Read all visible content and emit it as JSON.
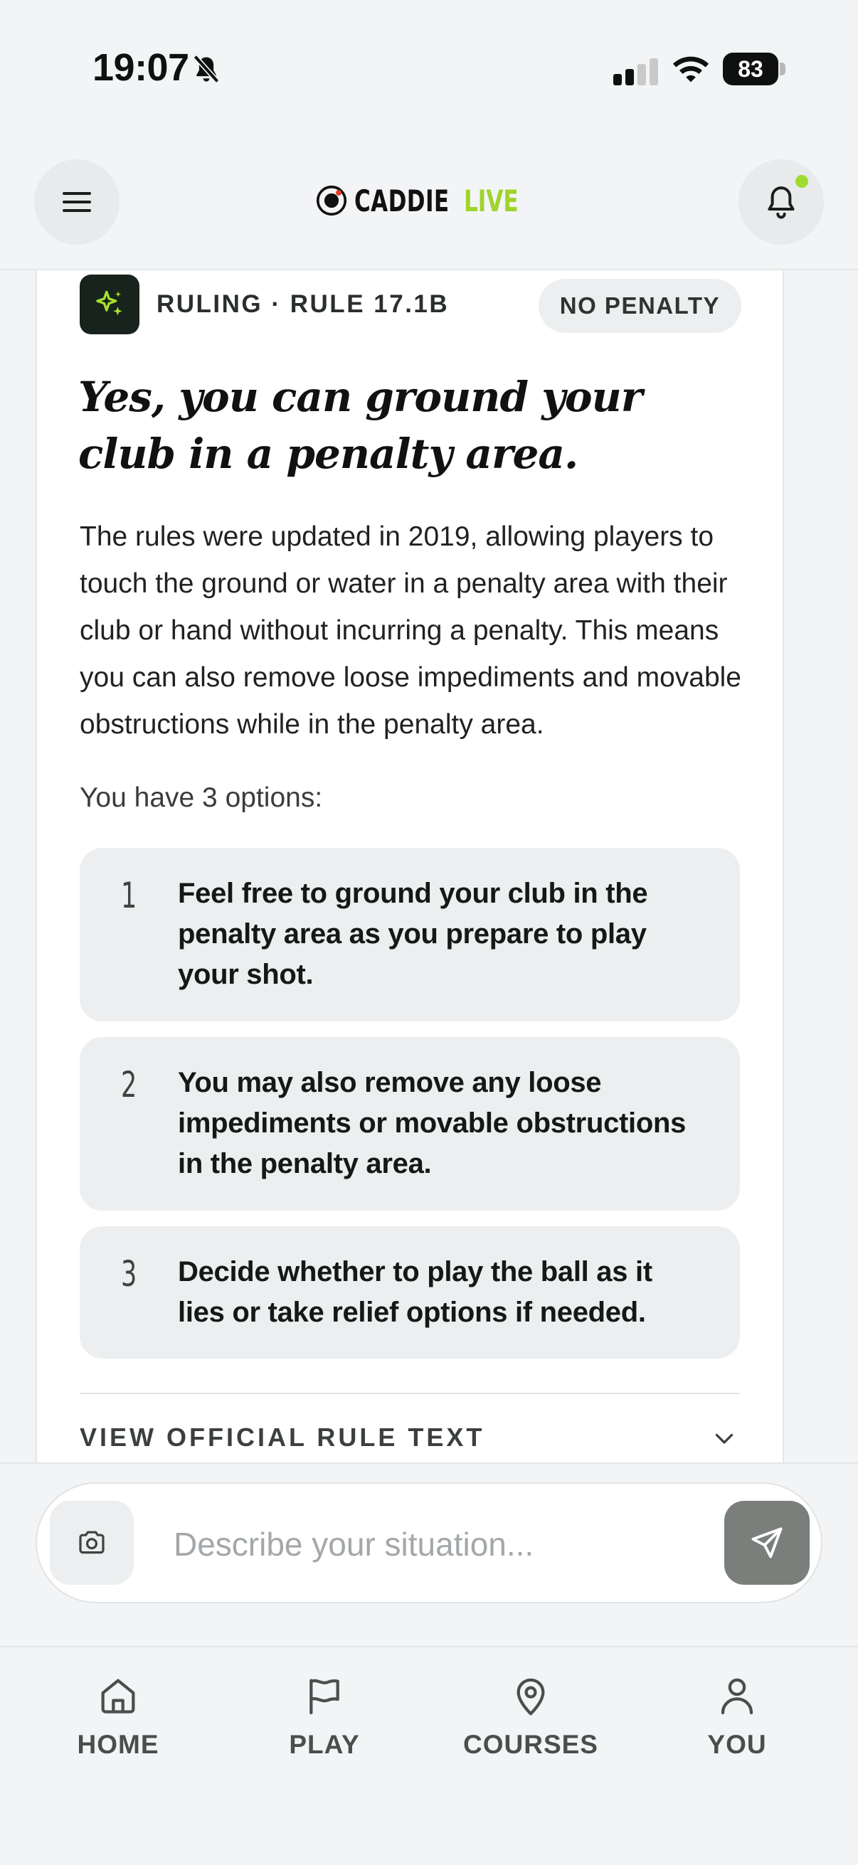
{
  "status_bar": {
    "time": "19:07",
    "battery": "83"
  },
  "header": {
    "brand_name": "CADDIE",
    "brand_tag": "LIVE",
    "accent_color": "#9fd42a"
  },
  "ruling": {
    "label": "RULING · RULE 17.1B",
    "badge": "NO PENALTY",
    "title": "Yes, you can ground your club in a penalty area.",
    "body": "The rules were updated in 2019, allowing players to touch the ground or water in a penalty area with their club or hand without incurring a penalty. This means you can also remove loose impediments and movable obstructions while in the penalty area.",
    "options_intro": "You have 3 options:",
    "options": [
      {
        "number": "1",
        "text": "Feel free to ground your club in the penalty area as you prepare to play your shot."
      },
      {
        "number": "2",
        "text": "You may also remove any loose impediments or movable obstructions in the penalty area."
      },
      {
        "number": "3",
        "text": "Decide whether to play the ball as it lies or take relief options if needed."
      }
    ],
    "view_rule_label": "VIEW OFFICIAL RULE TEXT"
  },
  "composer": {
    "placeholder": "Describe your situation..."
  },
  "nav": {
    "items": [
      {
        "label": "HOME",
        "icon": "home-icon"
      },
      {
        "label": "PLAY",
        "icon": "flag-icon"
      },
      {
        "label": "COURSES",
        "icon": "map-pin-icon"
      },
      {
        "label": "YOU",
        "icon": "user-icon"
      }
    ]
  }
}
